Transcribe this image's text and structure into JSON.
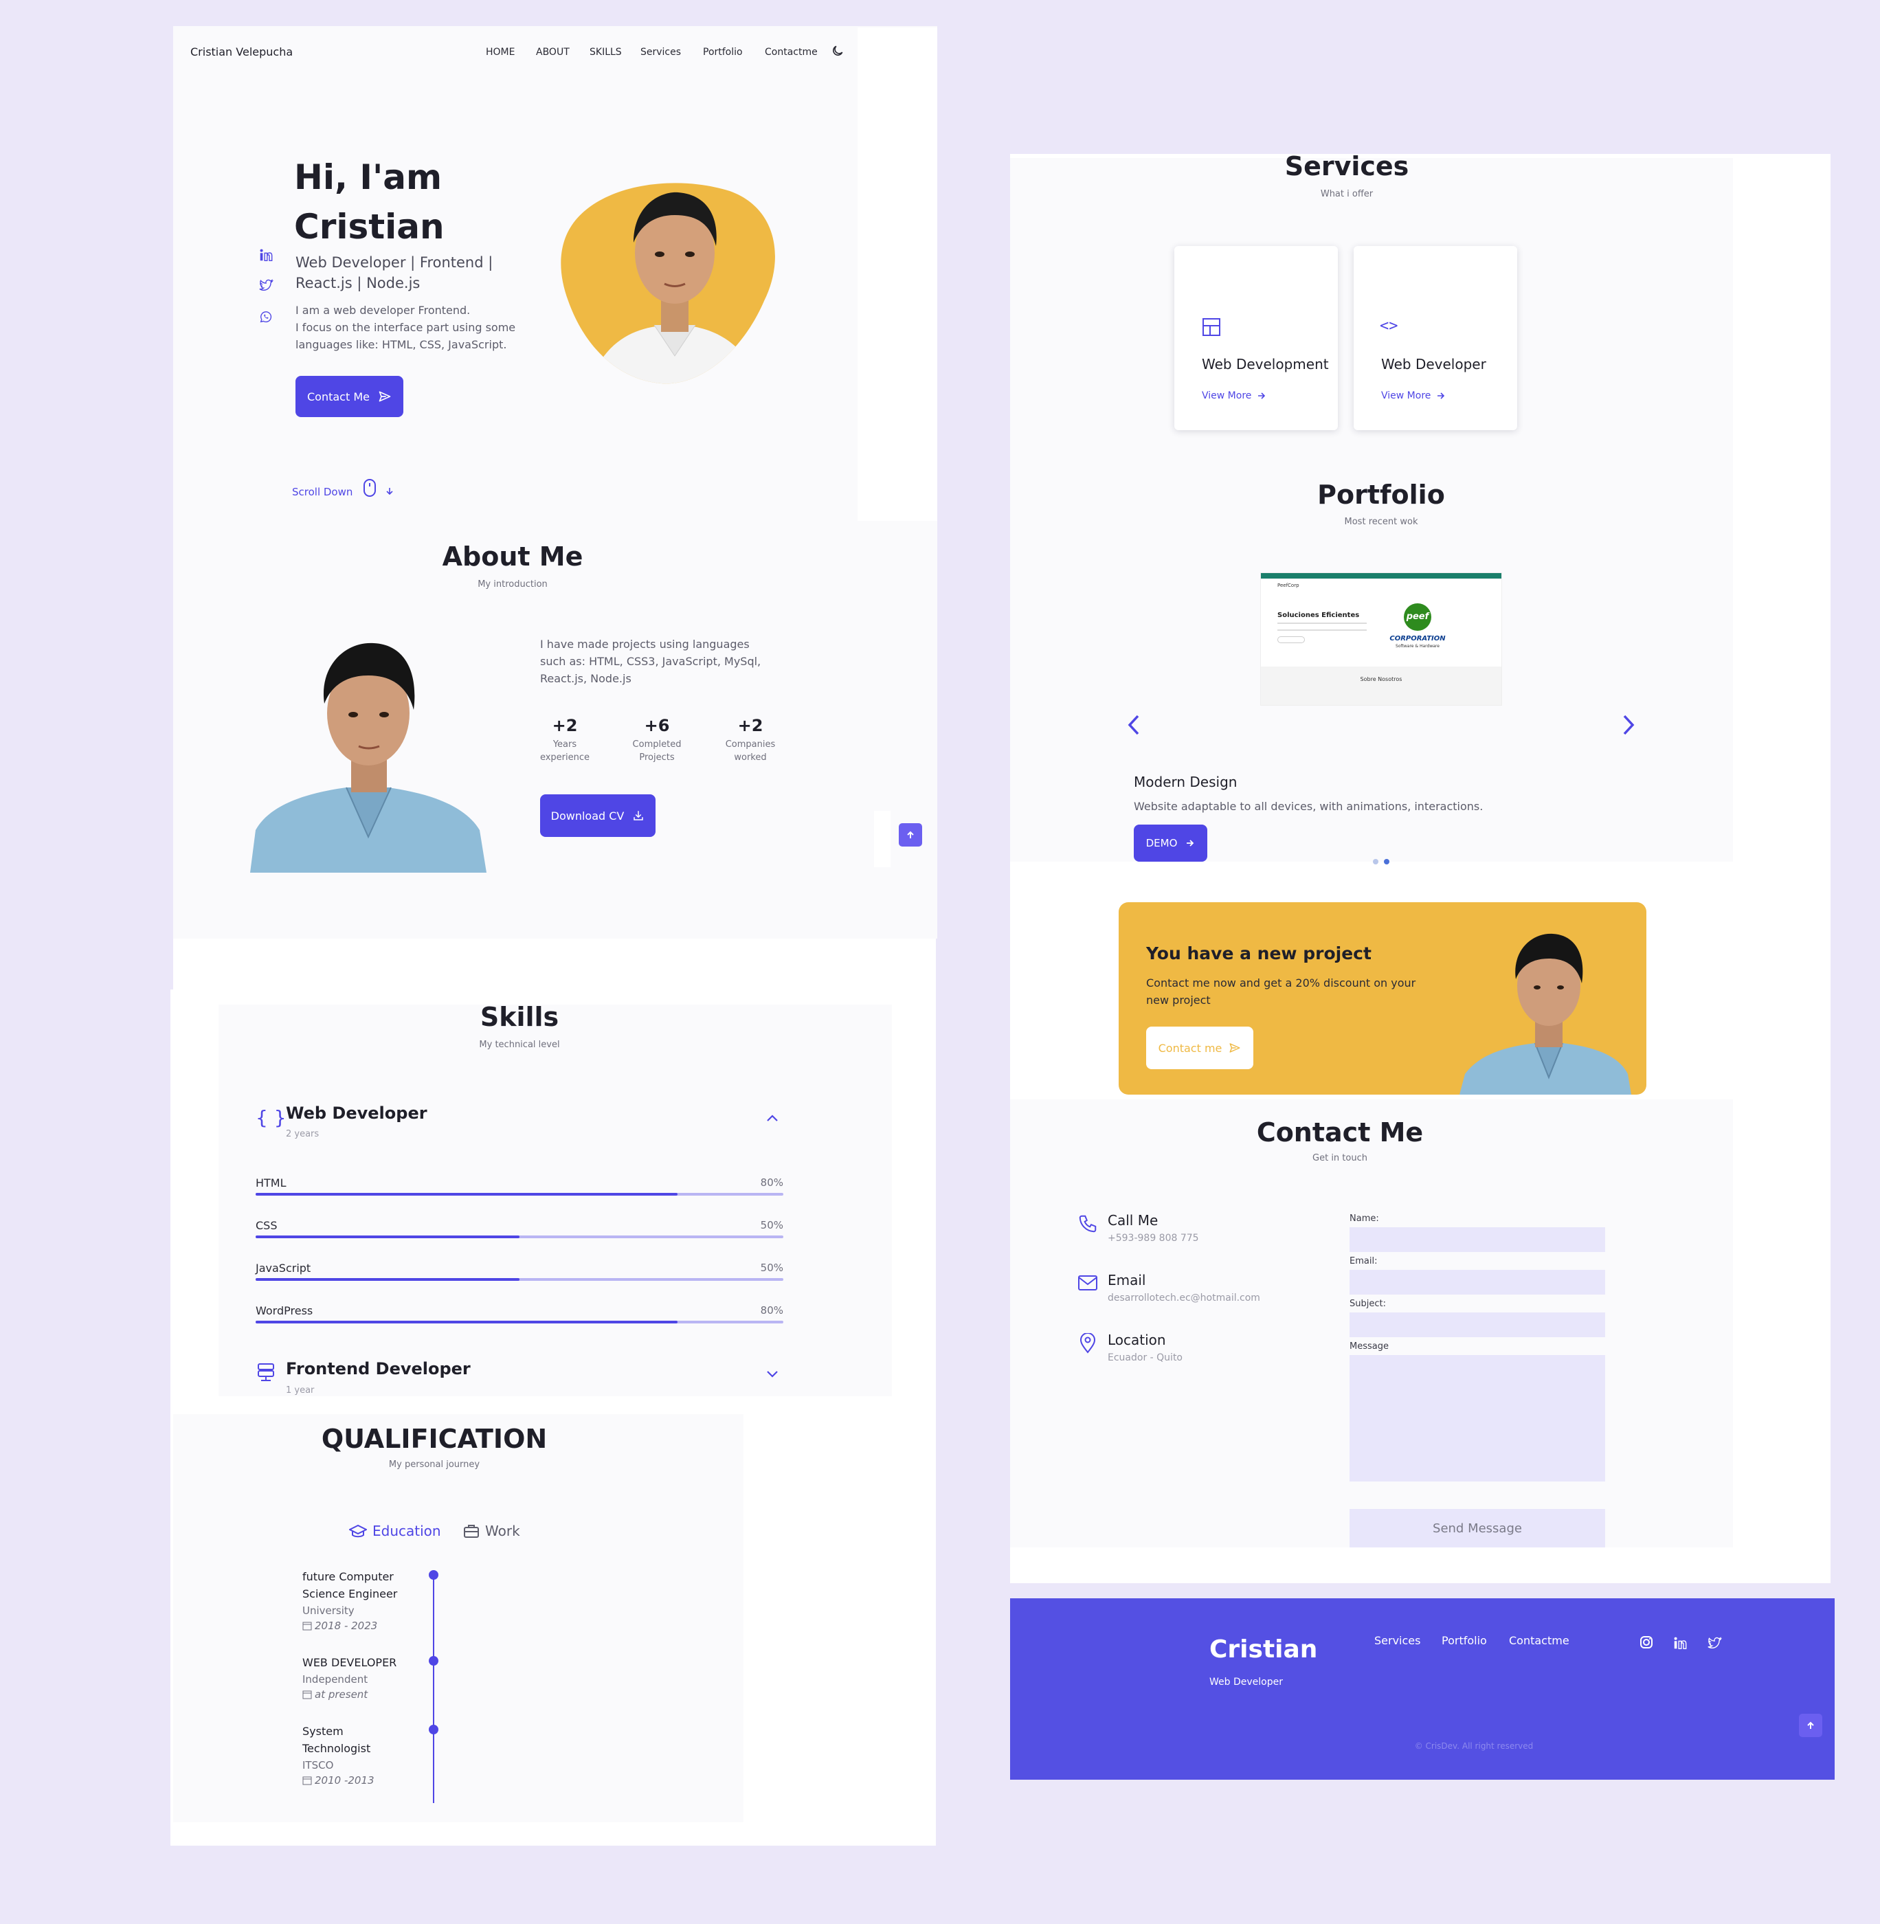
{
  "nav": {
    "brand": "Cristian Velepucha",
    "items": [
      "HOME",
      "ABOUT",
      "SKILLS",
      "Services",
      "Portfolio",
      "Contactme"
    ]
  },
  "hero": {
    "greeting_line1": "Hi, I'am",
    "greeting_line2": "Cristian",
    "subtitle_line1": "Web Developer | Frontend |",
    "subtitle_line2": "React.js | Node.js",
    "desc_line1": "I am a web developer Frontend.",
    "desc_line2": "I focus on the interface part using some",
    "desc_line3": "languages like: HTML, CSS, JavaScript.",
    "contact_button": "Contact Me",
    "scroll_down": "Scroll Down"
  },
  "about": {
    "title": "About Me",
    "subtitle": "My introduction",
    "desc_line1": "I have made projects using languages",
    "desc_line2": "such as: HTML, CSS3, JavaScript, MySql,",
    "desc_line3": "React.js, Node.js",
    "stats": [
      {
        "value": "+2",
        "label1": "Years",
        "label2": "experience"
      },
      {
        "value": "+6",
        "label1": "Completed",
        "label2": "Projects"
      },
      {
        "value": "+2",
        "label1": "Companies",
        "label2": "worked"
      }
    ],
    "download_button": "Download CV"
  },
  "skills": {
    "title": "Skills",
    "subtitle": "My technical level",
    "group1": {
      "title": "Web Developer",
      "years": "2 years"
    },
    "items": [
      {
        "name": "HTML",
        "pct_label": "80%",
        "level": 0.8
      },
      {
        "name": "CSS",
        "pct_label": "50%",
        "level": 0.5
      },
      {
        "name": "JavaScript",
        "pct_label": "50%",
        "level": 0.5
      },
      {
        "name": "WordPress",
        "pct_label": "80%",
        "level": 0.8
      }
    ],
    "group2": {
      "title": "Frontend Developer",
      "years": "1 year"
    }
  },
  "qualification": {
    "title": "QUALIFICATION",
    "subtitle": "My personal journey",
    "tab_education": "Education",
    "tab_work": "Work",
    "entries": [
      {
        "line1": "future Computer",
        "line2": "Science Engineer",
        "place": "University",
        "date": "2018 - 2023"
      },
      {
        "line1": "WEB DEVELOPER",
        "line2": "",
        "place": "Independent",
        "date": "at present"
      },
      {
        "line1": "System",
        "line2": "Technologist",
        "place": "ITSCO",
        "date": "2010 -2013"
      }
    ]
  },
  "services": {
    "title": "Services",
    "subtitle": "What i offer",
    "cards": [
      {
        "title": "Web Development",
        "link": "View More"
      },
      {
        "title": "Web Developer",
        "link": "View More"
      }
    ]
  },
  "portfolio": {
    "title": "Portfolio",
    "subtitle": "Most recent wok",
    "preview": {
      "heading": "Soluciones Eficientes",
      "logo_text": "peef",
      "corp": "CORPORATION",
      "corp_sub": "Software & Hardware",
      "brand": "PeefCorp",
      "section": "Sobre Nosotros"
    },
    "project_title": "Modern Design",
    "project_desc": "Website adaptable to all devices, with animations, interactions.",
    "demo_button": "DEMO"
  },
  "project_cta": {
    "title": "You have a new project",
    "desc_line1": "Contact me now and get a 20% discount on your",
    "desc_line2": "new project",
    "button": "Contact me"
  },
  "contact": {
    "title": "Contact Me",
    "subtitle": "Get in touch",
    "items": [
      {
        "label": "Call Me",
        "value": "+593-989 808 775"
      },
      {
        "label": "Email",
        "value": "desarrollotech.ec@hotmail.com"
      },
      {
        "label": "Location",
        "value": "Ecuador - Quito"
      }
    ],
    "form": {
      "name_label": "Name:",
      "email_label": "Email:",
      "subject_label": "Subject:",
      "message_label": "Message",
      "send_button": "Send Message"
    }
  },
  "footer": {
    "name": "Cristian",
    "role": "Web Developer",
    "links": [
      "Services",
      "Portfolio",
      "Contactme"
    ],
    "copyright": "© CrisDev. All right reserved"
  },
  "colors": {
    "accent": "#4f46e5",
    "yellow": "#efb944",
    "footer_bg": "#5450e3",
    "page_bg": "#ebe7f9"
  }
}
